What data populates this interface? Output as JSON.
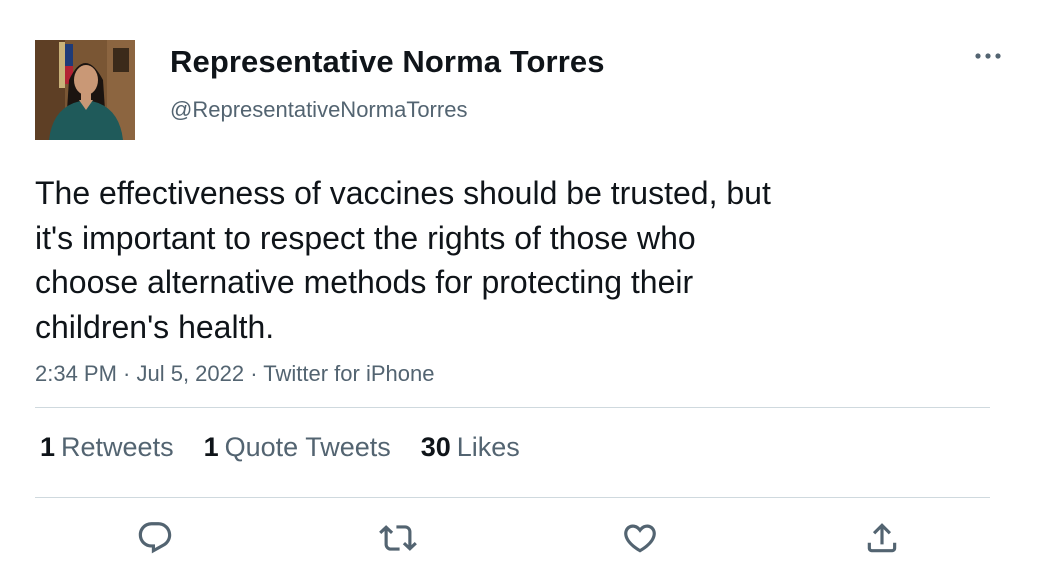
{
  "author": {
    "display_name": "Representative Norma Torres",
    "handle": "@RepresentativeNormaTorres",
    "avatar_icon": "profile-photo"
  },
  "tweet": {
    "text_lines": [
      "The effectiveness of vaccines should be trusted, but",
      "it's important to respect the rights of those who",
      "choose alternative methods for protecting their",
      "children's health."
    ],
    "time": "2:34 PM",
    "date": "Jul 5, 2022",
    "source": "Twitter for iPhone",
    "meta_line": "2:34 PM · Jul 5, 2022 · Twitter for iPhone"
  },
  "stats": {
    "retweets_count": "1",
    "retweets_label": "Retweets",
    "quotes_count": "1",
    "quotes_label": "Quote Tweets",
    "likes_count": "30",
    "likes_label": "Likes"
  },
  "actions": [
    "reply-icon",
    "retweet-icon",
    "like-icon",
    "share-icon"
  ],
  "colors": {
    "text_primary": "#0f1419",
    "text_secondary": "#536471",
    "divider": "#cfd9de",
    "icon": "#536471"
  }
}
